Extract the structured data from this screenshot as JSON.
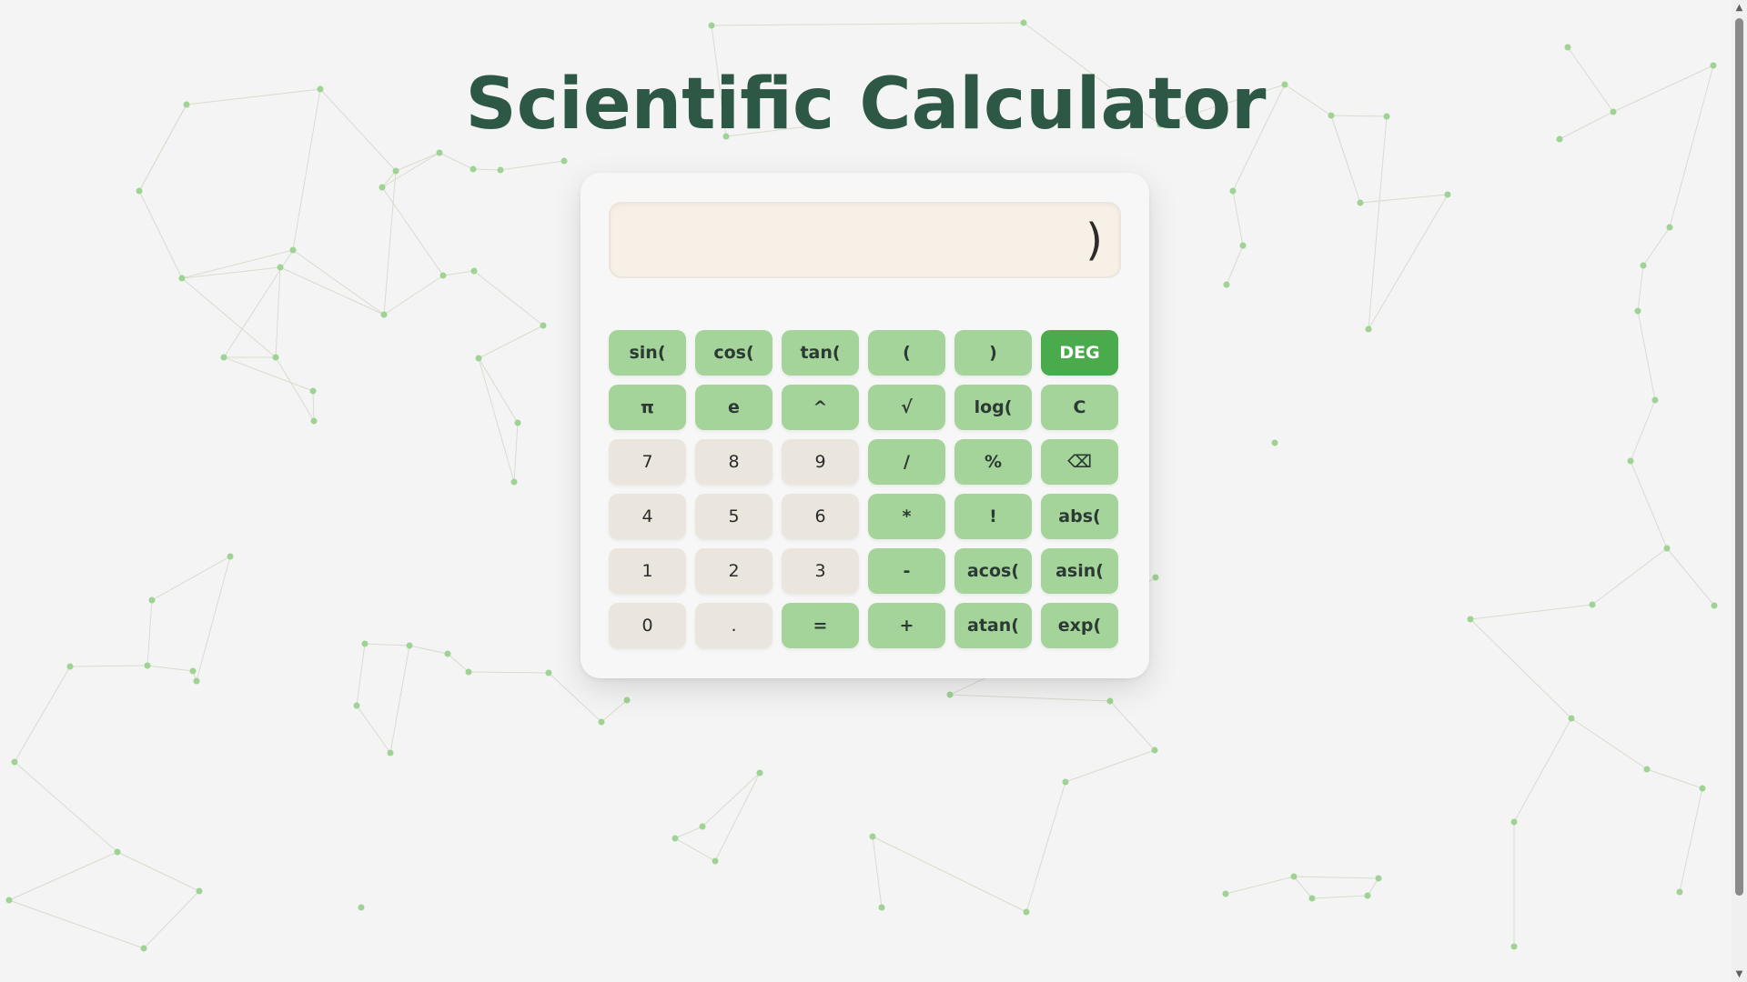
{
  "page": {
    "title": "Scientific Calculator"
  },
  "calculator": {
    "display_value": ")",
    "buttons": [
      {
        "label": "sin(",
        "style": "fn",
        "name": "sin-button"
      },
      {
        "label": "cos(",
        "style": "fn",
        "name": "cos-button"
      },
      {
        "label": "tan(",
        "style": "fn",
        "name": "tan-button"
      },
      {
        "label": "(",
        "style": "fn",
        "name": "open-paren-button"
      },
      {
        "label": ")",
        "style": "fn",
        "name": "close-paren-button"
      },
      {
        "label": "DEG",
        "style": "accent",
        "name": "deg-toggle-button"
      },
      {
        "label": "π",
        "style": "fn",
        "name": "pi-button"
      },
      {
        "label": "e",
        "style": "fn",
        "name": "euler-button"
      },
      {
        "label": "^",
        "style": "fn",
        "name": "power-button"
      },
      {
        "label": "√",
        "style": "fn",
        "name": "sqrt-button"
      },
      {
        "label": "log(",
        "style": "fn",
        "name": "log-button"
      },
      {
        "label": "C",
        "style": "fn",
        "name": "clear-button"
      },
      {
        "label": "7",
        "style": "num",
        "name": "digit-7-button"
      },
      {
        "label": "8",
        "style": "num",
        "name": "digit-8-button"
      },
      {
        "label": "9",
        "style": "num",
        "name": "digit-9-button"
      },
      {
        "label": "/",
        "style": "fn",
        "name": "divide-button"
      },
      {
        "label": "%",
        "style": "fn",
        "name": "percent-button"
      },
      {
        "label": "⌫",
        "style": "fn",
        "name": "backspace-icon-button"
      },
      {
        "label": "4",
        "style": "num",
        "name": "digit-4-button"
      },
      {
        "label": "5",
        "style": "num",
        "name": "digit-5-button"
      },
      {
        "label": "6",
        "style": "num",
        "name": "digit-6-button"
      },
      {
        "label": "*",
        "style": "fn",
        "name": "multiply-button"
      },
      {
        "label": "!",
        "style": "fn",
        "name": "factorial-button"
      },
      {
        "label": "abs(",
        "style": "fn",
        "name": "abs-button"
      },
      {
        "label": "1",
        "style": "num",
        "name": "digit-1-button"
      },
      {
        "label": "2",
        "style": "num",
        "name": "digit-2-button"
      },
      {
        "label": "3",
        "style": "num",
        "name": "digit-3-button"
      },
      {
        "label": "-",
        "style": "fn",
        "name": "subtract-button"
      },
      {
        "label": "acos(",
        "style": "fn",
        "name": "acos-button"
      },
      {
        "label": "asin(",
        "style": "fn",
        "name": "asin-button"
      },
      {
        "label": "0",
        "style": "num",
        "name": "digit-0-button"
      },
      {
        "label": ".",
        "style": "num",
        "name": "decimal-button"
      },
      {
        "label": "=",
        "style": "fn",
        "name": "equals-button"
      },
      {
        "label": "+",
        "style": "fn",
        "name": "add-button"
      },
      {
        "label": "atan(",
        "style": "fn",
        "name": "atan-button"
      },
      {
        "label": "exp(",
        "style": "fn",
        "name": "exp-button"
      }
    ]
  },
  "scrollbar": {
    "up_icon": "▲",
    "down_icon": "▼"
  },
  "colors": {
    "title": "#2e5846",
    "function_button": "#a4d49a",
    "number_button": "#ebe6dd",
    "accent_button": "#4aab4d",
    "display_bg": "#f7f0e6",
    "network_node": "#9fd393",
    "network_line": "#d8dccf"
  }
}
